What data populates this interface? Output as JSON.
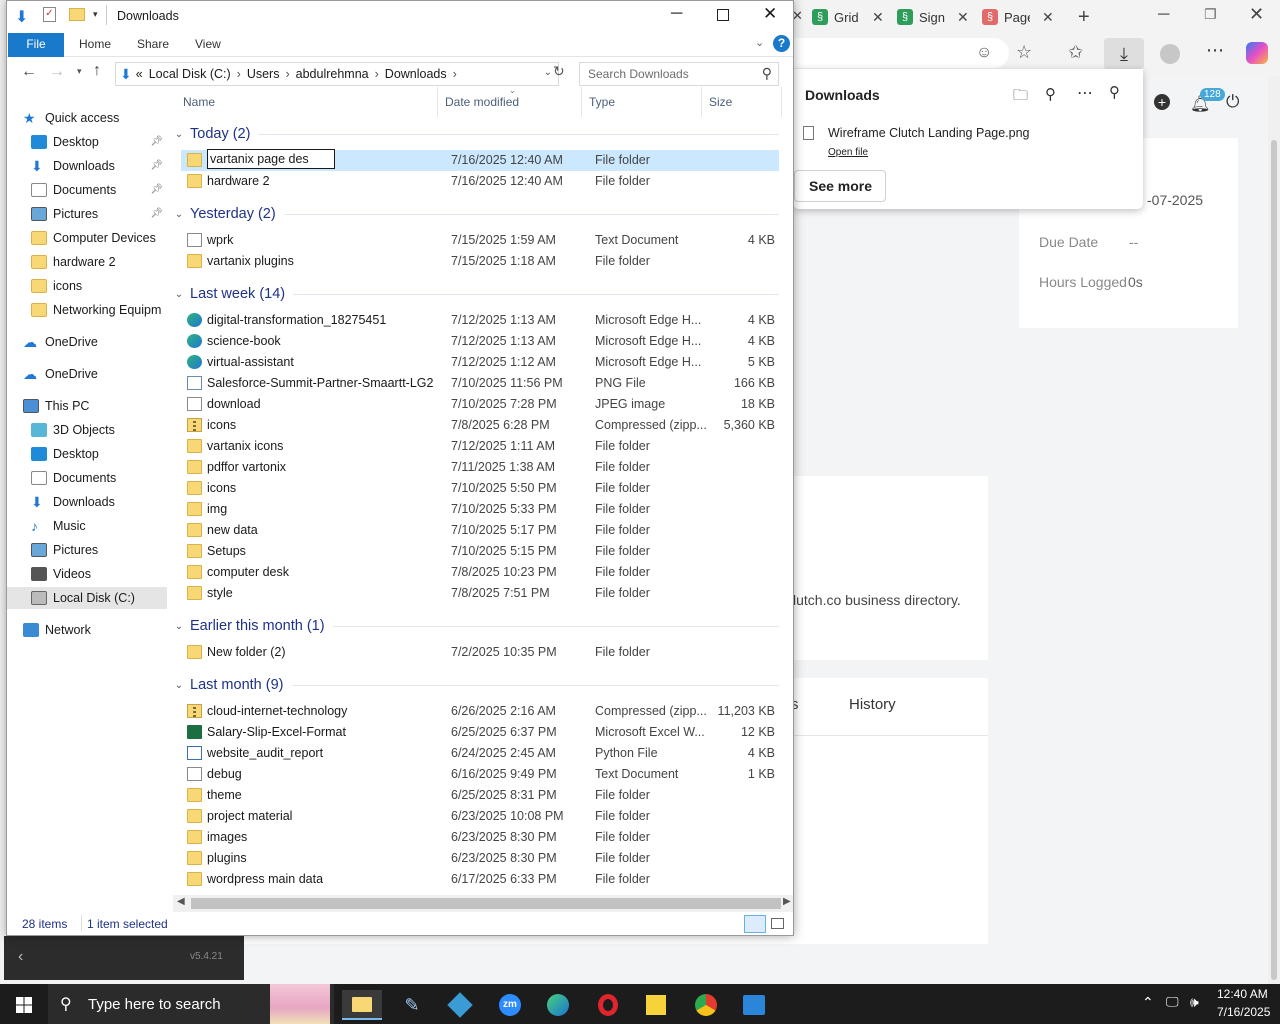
{
  "browser": {
    "tabs": [
      {
        "label": "Grid",
        "color": "#2e9d5a"
      },
      {
        "label": "Sign",
        "color": "#2e9d5a"
      },
      {
        "label": "Page",
        "color": "#e06b6b"
      }
    ],
    "downloads_panel": {
      "title": "Downloads",
      "file": "Wireframe Clutch Landing Page.png",
      "open_file": "Open file",
      "see_more": "See more"
    },
    "notif_count": "128",
    "page": {
      "date_fragment": "-07-2025",
      "due_date_label": "Due Date",
      "due_date_value": "--",
      "hours_logged_label": "Hours Logged",
      "hours_logged_value": "0s",
      "directory_text": "lutch.co business directory.",
      "tab_fragment": "s",
      "history_tab": "History",
      "version": "v5.4.21"
    }
  },
  "explorer": {
    "title": "Downloads",
    "ribbon": [
      "File",
      "Home",
      "Share",
      "View"
    ],
    "breadcrumb": [
      "«",
      "Local Disk (C:)",
      "Users",
      "abdulrehmna",
      "Downloads"
    ],
    "search_placeholder": "Search Downloads",
    "columns": {
      "name": "Name",
      "date": "Date modified",
      "type": "Type",
      "size": "Size"
    },
    "nav": [
      {
        "label": "Quick access",
        "icon": "star-icon"
      },
      {
        "label": "Desktop",
        "icon": "desktop-icon",
        "pin": true
      },
      {
        "label": "Downloads",
        "icon": "download-icon",
        "pin": true
      },
      {
        "label": "Documents",
        "icon": "documents-icon",
        "pin": true
      },
      {
        "label": "Pictures",
        "icon": "pictures-icon",
        "pin": true
      },
      {
        "label": "Computer Devices",
        "icon": "folder-icon"
      },
      {
        "label": "hardware 2",
        "icon": "folder-icon"
      },
      {
        "label": "icons",
        "icon": "folder-icon"
      },
      {
        "label": "Networking Equipm",
        "icon": "folder-icon"
      },
      {
        "label": "OneDrive",
        "icon": "cloud-icon"
      },
      {
        "label": "OneDrive",
        "icon": "cloud-icon"
      },
      {
        "label": "This PC",
        "icon": "pc-icon"
      },
      {
        "label": "3D Objects",
        "icon": "cube-icon"
      },
      {
        "label": "Desktop",
        "icon": "desktop-icon"
      },
      {
        "label": "Documents",
        "icon": "documents-icon"
      },
      {
        "label": "Downloads",
        "icon": "download-icon"
      },
      {
        "label": "Music",
        "icon": "music-icon"
      },
      {
        "label": "Pictures",
        "icon": "pictures-icon"
      },
      {
        "label": "Videos",
        "icon": "videos-icon"
      },
      {
        "label": "Local Disk (C:)",
        "icon": "disk-icon"
      },
      {
        "label": "Network",
        "icon": "network-icon"
      }
    ],
    "groups": [
      {
        "label": "Today (2)",
        "rows": [
          {
            "name": "vartanix page des",
            "date": "7/16/2025 12:40 AM",
            "type": "File folder",
            "size": "",
            "icon": "folder",
            "renaming": true
          },
          {
            "name": "hardware 2",
            "date": "7/16/2025 12:40 AM",
            "type": "File folder",
            "size": "",
            "icon": "folder"
          }
        ]
      },
      {
        "label": "Yesterday (2)",
        "rows": [
          {
            "name": "wprk",
            "date": "7/15/2025 1:59 AM",
            "type": "Text Document",
            "size": "4 KB",
            "icon": "doc"
          },
          {
            "name": "vartanix plugins",
            "date": "7/15/2025 1:18 AM",
            "type": "File folder",
            "size": "",
            "icon": "folder"
          }
        ]
      },
      {
        "label": "Last week (14)",
        "rows": [
          {
            "name": "digital-transformation_18275451",
            "date": "7/12/2025 1:13 AM",
            "type": "Microsoft Edge H...",
            "size": "4 KB",
            "icon": "edge"
          },
          {
            "name": "science-book",
            "date": "7/12/2025 1:13 AM",
            "type": "Microsoft Edge H...",
            "size": "4 KB",
            "icon": "edge"
          },
          {
            "name": "virtual-assistant",
            "date": "7/12/2025 1:12 AM",
            "type": "Microsoft Edge H...",
            "size": "5 KB",
            "icon": "edge"
          },
          {
            "name": "Salesforce-Summit-Partner-Smaartt-LG2",
            "date": "7/10/2025 11:56 PM",
            "type": "PNG File",
            "size": "166 KB",
            "icon": "png"
          },
          {
            "name": "download",
            "date": "7/10/2025 7:28 PM",
            "type": "JPEG image",
            "size": "18 KB",
            "icon": "jpg"
          },
          {
            "name": "icons",
            "date": "7/8/2025 6:28 PM",
            "type": "Compressed (zipp...",
            "size": "5,360 KB",
            "icon": "zip"
          },
          {
            "name": "vartanix icons",
            "date": "7/12/2025 1:11 AM",
            "type": "File folder",
            "size": "",
            "icon": "folder"
          },
          {
            "name": "pdffor vartonix",
            "date": "7/11/2025 1:38 AM",
            "type": "File folder",
            "size": "",
            "icon": "folder"
          },
          {
            "name": "icons",
            "date": "7/10/2025 5:50 PM",
            "type": "File folder",
            "size": "",
            "icon": "folder"
          },
          {
            "name": "img",
            "date": "7/10/2025 5:33 PM",
            "type": "File folder",
            "size": "",
            "icon": "folder"
          },
          {
            "name": "new data",
            "date": "7/10/2025 5:17 PM",
            "type": "File folder",
            "size": "",
            "icon": "folder"
          },
          {
            "name": "Setups",
            "date": "7/10/2025 5:15 PM",
            "type": "File folder",
            "size": "",
            "icon": "folder"
          },
          {
            "name": "computer desk",
            "date": "7/8/2025 10:23 PM",
            "type": "File folder",
            "size": "",
            "icon": "folder"
          },
          {
            "name": "style",
            "date": "7/8/2025 7:51 PM",
            "type": "File folder",
            "size": "",
            "icon": "folder"
          }
        ]
      },
      {
        "label": "Earlier this month (1)",
        "rows": [
          {
            "name": "New folder (2)",
            "date": "7/2/2025 10:35 PM",
            "type": "File folder",
            "size": "",
            "icon": "folder"
          }
        ]
      },
      {
        "label": "Last month (9)",
        "rows": [
          {
            "name": "cloud-internet-technology",
            "date": "6/26/2025 2:16 AM",
            "type": "Compressed (zipp...",
            "size": "11,203 KB",
            "icon": "zip"
          },
          {
            "name": "Salary-Slip-Excel-Format",
            "date": "6/25/2025 6:37 PM",
            "type": "Microsoft Excel W...",
            "size": "12 KB",
            "icon": "xls"
          },
          {
            "name": "website_audit_report",
            "date": "6/24/2025 2:45 AM",
            "type": "Python File",
            "size": "4 KB",
            "icon": "py"
          },
          {
            "name": "debug",
            "date": "6/16/2025 9:49 PM",
            "type": "Text Document",
            "size": "1 KB",
            "icon": "doc"
          },
          {
            "name": "theme",
            "date": "6/25/2025 8:31 PM",
            "type": "File folder",
            "size": "",
            "icon": "folder"
          },
          {
            "name": "project material",
            "date": "6/23/2025 10:08 PM",
            "type": "File folder",
            "size": "",
            "icon": "folder"
          },
          {
            "name": "images",
            "date": "6/23/2025 8:30 PM",
            "type": "File folder",
            "size": "",
            "icon": "folder"
          },
          {
            "name": "plugins",
            "date": "6/23/2025 8:30 PM",
            "type": "File folder",
            "size": "",
            "icon": "folder"
          },
          {
            "name": "wordpress main data",
            "date": "6/17/2025 6:33 PM",
            "type": "File folder",
            "size": "",
            "icon": "folder"
          }
        ]
      }
    ],
    "status": {
      "items": "28 items",
      "selected": "1 item selected"
    }
  },
  "taskbar": {
    "search_placeholder": "Type here to search",
    "time": "12:40 AM",
    "date": "7/16/2025"
  }
}
